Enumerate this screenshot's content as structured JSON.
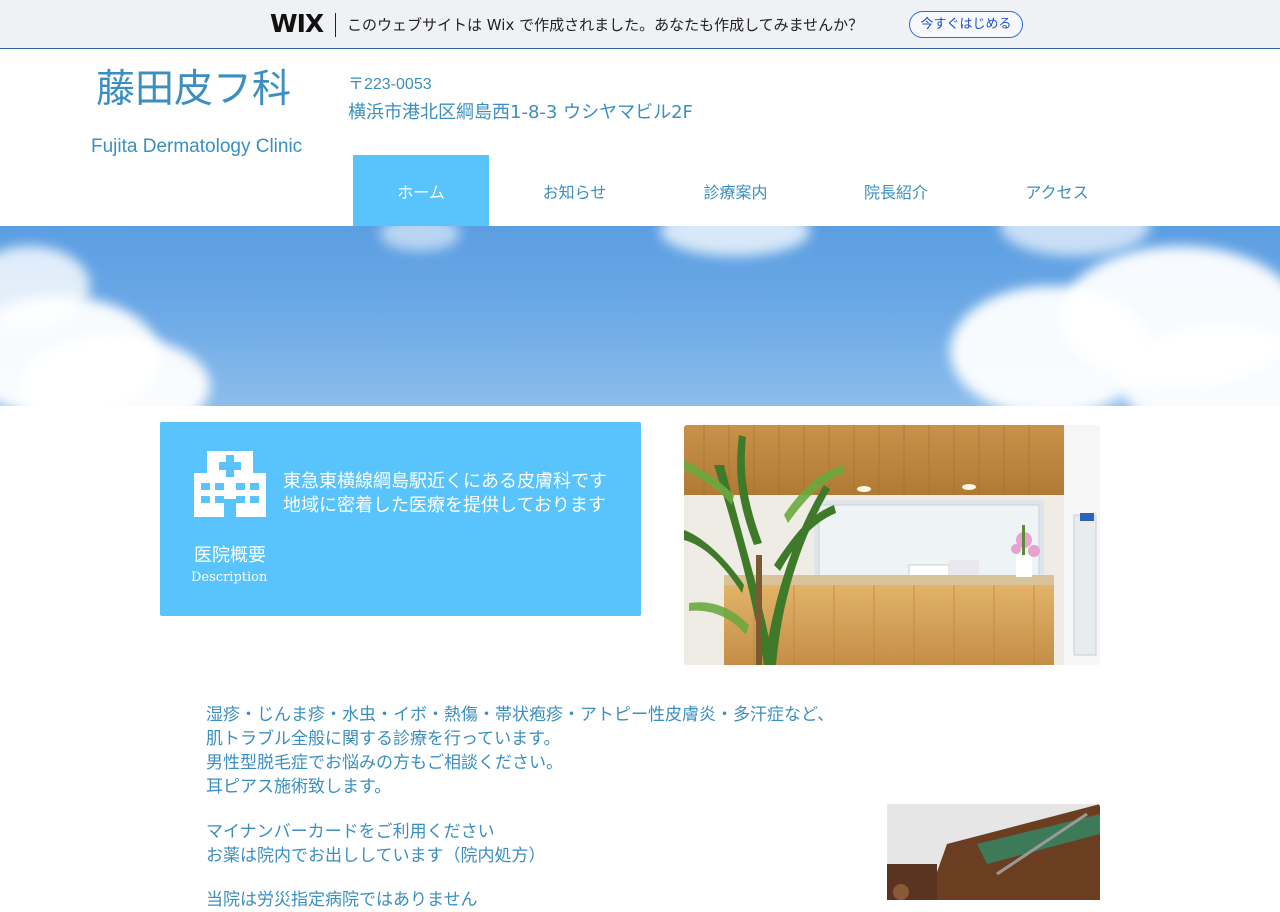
{
  "wix_banner": {
    "logo": "WIX",
    "message": "このウェブサイトは Wix で作成されました。あなたも作成してみませんか？",
    "cta_label": "今すぐはじめる"
  },
  "header": {
    "title": "藤田皮フ科",
    "subtitle": "Fujita Dermatology Clinic",
    "postal_code": "〒223-0053",
    "address": "横浜市港北区綱島西1-8-3  ウシヤマビル2F"
  },
  "nav": {
    "items": [
      {
        "label": "ホーム",
        "active": true
      },
      {
        "label": "お知らせ",
        "active": false
      },
      {
        "label": "診療案内",
        "active": false
      },
      {
        "label": "院長紹介",
        "active": false
      },
      {
        "label": "アクセス",
        "active": false
      }
    ]
  },
  "info": {
    "icon": "hospital-icon",
    "line1": "東急東横線綱島駅近くにある皮膚科です",
    "line2": "地域に密着した医療を提供しております",
    "label_jp": "医院概要",
    "label_en": "Description"
  },
  "body": {
    "lines": [
      "湿疹・じんま疹・水虫・イボ・熱傷・帯状疱疹・アトピー性皮膚炎・多汗症など、",
      "肌トラブル全般に関する診療を行っています。",
      "男性型脱毛症でお悩みの方もご相談ください。",
      "耳ピアス施術致します。",
      "マイナンバーカードをご利用ください",
      "お薬は院内でお出ししています（院内処方）",
      "当院は労災指定病院ではありません"
    ]
  },
  "colors": {
    "accent": "#58c4fb",
    "text": "#3a8fc0",
    "wix_link": "#2b6ce6"
  }
}
